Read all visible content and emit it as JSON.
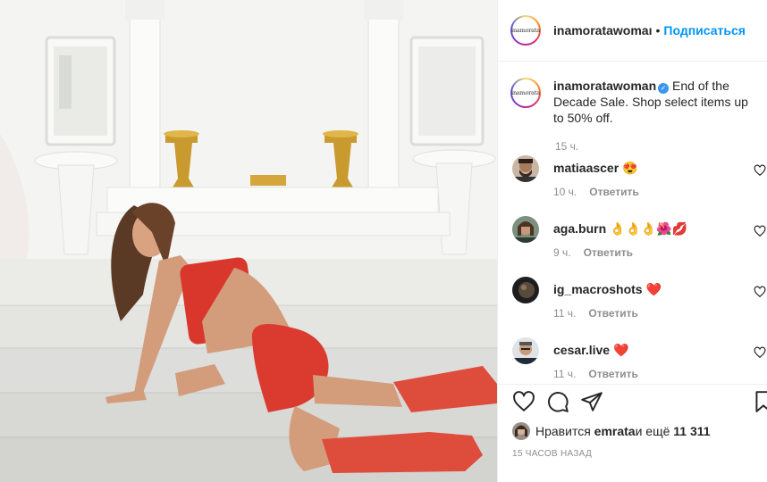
{
  "post": {
    "image_description": "",
    "account": {
      "username": "inamoratawoman",
      "username_header": "inamoratawomaı",
      "avatar_text": "inamorata",
      "follow_separator": "•",
      "follow_label": "Подписаться",
      "verified": true
    },
    "caption": {
      "username": "inamoratawoman",
      "text": " End of the Decade Sale. Shop select items up to 50% off.",
      "time": "15 ч."
    },
    "comments": [
      {
        "username": "matiaascer",
        "text": " 😍",
        "time": "10 ч.",
        "reply_label": "Ответить",
        "avatar": "bearded-man-avatar"
      },
      {
        "username": "aga.burn",
        "text": " 👌👌👌🌺💋",
        "time": "9 ч.",
        "reply_label": "Ответить",
        "avatar": "woman-avatar"
      },
      {
        "username": "ig_macroshots",
        "text": " ❤️",
        "time": "11 ч.",
        "reply_label": "Ответить",
        "avatar": "dark-avatar"
      },
      {
        "username": "cesar.live",
        "text": " ❤️",
        "time": "11 ч.",
        "reply_label": "Ответить",
        "avatar": "man-avatar"
      }
    ],
    "likes": {
      "prefix": "Нравится ",
      "user": "emrata",
      "middle": " и ещё ",
      "count": "11 311"
    },
    "posted_ago": "15 ЧАСОВ НАЗАД",
    "icons": [
      "heart-icon",
      "comment-icon",
      "share-icon",
      "bookmark-icon"
    ],
    "colors": {
      "link": "#0095f6",
      "muted": "#8e8e8e",
      "text": "#262626",
      "like_red": "#ed4956"
    }
  }
}
